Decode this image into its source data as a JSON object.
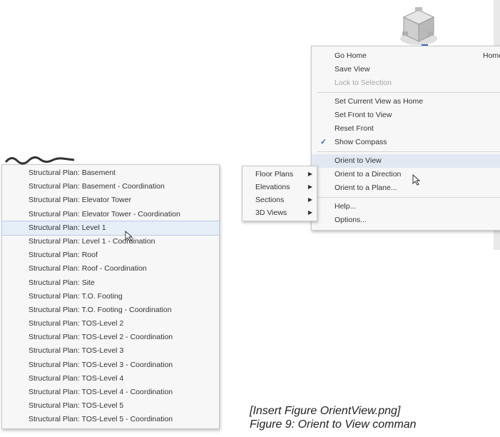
{
  "viewcube": {
    "icon": "view-cube-icon"
  },
  "main_menu": {
    "items": [
      {
        "label": "Go Home",
        "shortcut": "Home"
      },
      {
        "label": "Save View"
      },
      {
        "label": "Lock to Selection",
        "disabled": true
      },
      {
        "separator": true
      },
      {
        "label": "Set Current View as Home"
      },
      {
        "label": "Set Front to View",
        "submenu": true
      },
      {
        "label": "Reset Front"
      },
      {
        "label": "Show Compass",
        "checked": true
      },
      {
        "separator": true
      },
      {
        "label": "Orient to View",
        "submenu": true,
        "highlighted": true
      },
      {
        "label": "Orient to a Direction",
        "submenu": true
      },
      {
        "label": "Orient to a Plane..."
      },
      {
        "separator": true
      },
      {
        "label": "Help..."
      },
      {
        "label": "Options..."
      }
    ]
  },
  "views_menu": {
    "items": [
      "Floor Plans",
      "Elevations",
      "Sections",
      "3D Views"
    ]
  },
  "plans_menu": {
    "highlighted_index": 4,
    "items": [
      "Structural Plan: Basement",
      "Structural Plan: Basement - Coordination",
      "Structural Plan: Elevator Tower",
      "Structural Plan: Elevator Tower - Coordination",
      "Structural Plan: Level 1",
      "Structural Plan: Level 1 - Coordination",
      "Structural Plan: Roof",
      "Structural Plan: Roof - Coordination",
      "Structural Plan: Site",
      "Structural Plan: T.O. Footing",
      "Structural Plan: T.O. Footing - Coordination",
      "Structural Plan: TOS-Level 2",
      "Structural Plan: TOS-Level 2 - Coordination",
      "Structural Plan: TOS-Level 3",
      "Structural Plan: TOS-Level 3 - Coordination",
      "Structural Plan: TOS-Level 4",
      "Structural Plan: TOS-Level 4 - Coordination",
      "Structural Plan: TOS-Level 5",
      "Structural Plan: TOS-Level 5 - Coordination"
    ]
  },
  "caption": {
    "line1": "[Insert Figure OrientView.png]",
    "line2": "Figure 9: Orient to View comman"
  }
}
